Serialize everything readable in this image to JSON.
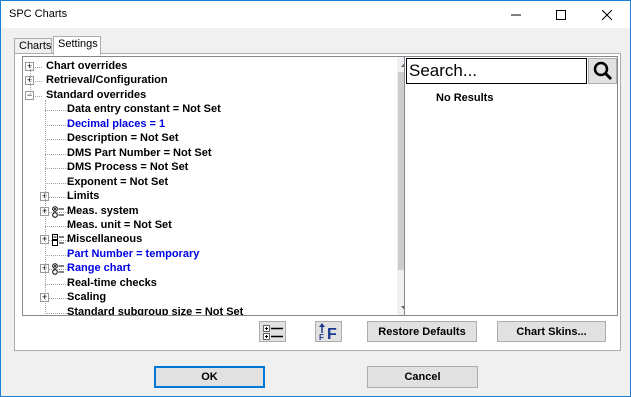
{
  "window": {
    "title": "SPC Charts"
  },
  "tabs": [
    {
      "label": "Charts"
    },
    {
      "label": "Settings"
    }
  ],
  "tree": {
    "items": [
      {
        "label": "Chart overrides",
        "expander": "+",
        "color": "black"
      },
      {
        "label": "Retrieval/Configuration",
        "expander": "+",
        "color": "black"
      },
      {
        "label": "Standard overrides",
        "expander": "−",
        "color": "black"
      },
      {
        "label": "Data entry constant = Not Set",
        "color": "black"
      },
      {
        "label": "Decimal places = 1",
        "color": "blue"
      },
      {
        "label": "Description = Not Set",
        "color": "black"
      },
      {
        "label": "DMS Part Number = Not Set",
        "color": "black"
      },
      {
        "label": "DMS Process = Not Set",
        "color": "black"
      },
      {
        "label": "Exponent = Not Set",
        "color": "black"
      },
      {
        "label": "Limits",
        "expander": "+",
        "color": "black"
      },
      {
        "label": "Meas. system",
        "expander": "+",
        "icon": "radio-list-icon",
        "color": "black"
      },
      {
        "label": "Meas. unit = Not Set",
        "color": "black"
      },
      {
        "label": "Miscellaneous",
        "expander": "+",
        "icon": "checkbox-list-icon",
        "color": "black"
      },
      {
        "label": "Part Number = temporary",
        "color": "blue"
      },
      {
        "label": "Range chart",
        "expander": "+",
        "icon": "radio-list-icon",
        "color": "blue"
      },
      {
        "label": "Real-time checks",
        "color": "black"
      },
      {
        "label": "Scaling",
        "expander": "+",
        "color": "black"
      },
      {
        "label": "Standard subgroup size = Not Set",
        "color": "black"
      }
    ]
  },
  "search": {
    "placeholder": "Search...",
    "no_results": "No Results"
  },
  "buttons": {
    "restore_defaults": "Restore Defaults",
    "chart_skins": "Chart Skins...",
    "ok": "OK",
    "cancel": "Cancel"
  },
  "colors": {
    "blue_text": "#0000e6",
    "accent": "#0078d7"
  }
}
